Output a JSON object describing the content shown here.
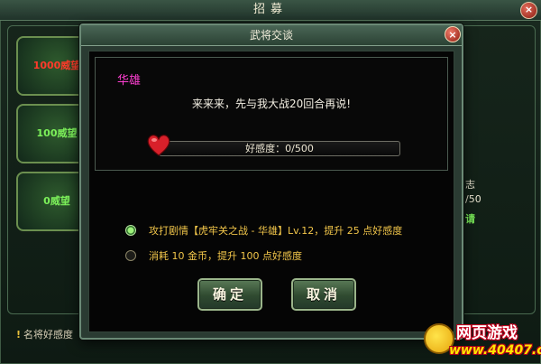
{
  "background_window": {
    "title": "招募",
    "close": "×",
    "cards": [
      {
        "label": "1000威望",
        "color": "red"
      },
      {
        "label": "100威望",
        "color": "green"
      },
      {
        "label": "0威望",
        "color": "green"
      }
    ],
    "right_frag_1": "志",
    "right_frag_2": "/50",
    "right_frag_3": "请",
    "bottom_note_mark": "!",
    "bottom_note": "名将好感度"
  },
  "dialog": {
    "title": "武将交谈",
    "close": "×",
    "speaker": "华雄",
    "speech": "来来来，先与我大战20回合再说!",
    "favor": {
      "label": "好感度：0/500",
      "current": 0,
      "max": 500
    },
    "options": [
      {
        "text": "攻打剧情【虎牢关之战 - 华雄】Lv.12，提升 25 点好感度",
        "selected": true
      },
      {
        "text": "消耗 10 金币，提升 100 点好感度",
        "selected": false
      }
    ],
    "confirm_label": "确定",
    "cancel_label": "取消"
  },
  "watermark": {
    "title": "网页游戏",
    "url": "www.40407.com"
  },
  "colors": {
    "speaker": "#ff3fd2",
    "option_text": "#f2c64a",
    "heart": "#d8202a"
  }
}
